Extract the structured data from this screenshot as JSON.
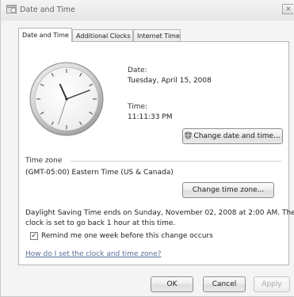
{
  "window": {
    "title": "Date and Time",
    "close_glyph": "✕"
  },
  "tabs": [
    {
      "label": "Date and Time"
    },
    {
      "label": "Additional Clocks"
    },
    {
      "label": "Internet Time"
    }
  ],
  "date": {
    "label": "Date:",
    "value": "Tuesday, April 15, 2008"
  },
  "time": {
    "label": "Time:",
    "value": "11:11:33 PM"
  },
  "clock": {
    "hours": 11,
    "minutes": 11,
    "seconds": 33
  },
  "change_datetime_button": "Change date and time...",
  "timezone": {
    "section_label": "Time zone",
    "value": "(GMT-05:00) Eastern Time (US & Canada)",
    "change_button": "Change time zone..."
  },
  "dst": {
    "line1": "Daylight Saving Time ends on Sunday, November 02, 2008 at 2:00 AM. The",
    "line2": "clock is set to go back 1 hour at this time."
  },
  "reminder": {
    "checked": true,
    "label": "Remind me one week before this change occurs"
  },
  "help_link": "How do I set the clock and time zone?",
  "footer": {
    "ok": "OK",
    "cancel": "Cancel",
    "apply": "Apply"
  },
  "icons": {
    "title": "date-time-icon",
    "shield": "uac-shield-icon",
    "check": "✓"
  }
}
